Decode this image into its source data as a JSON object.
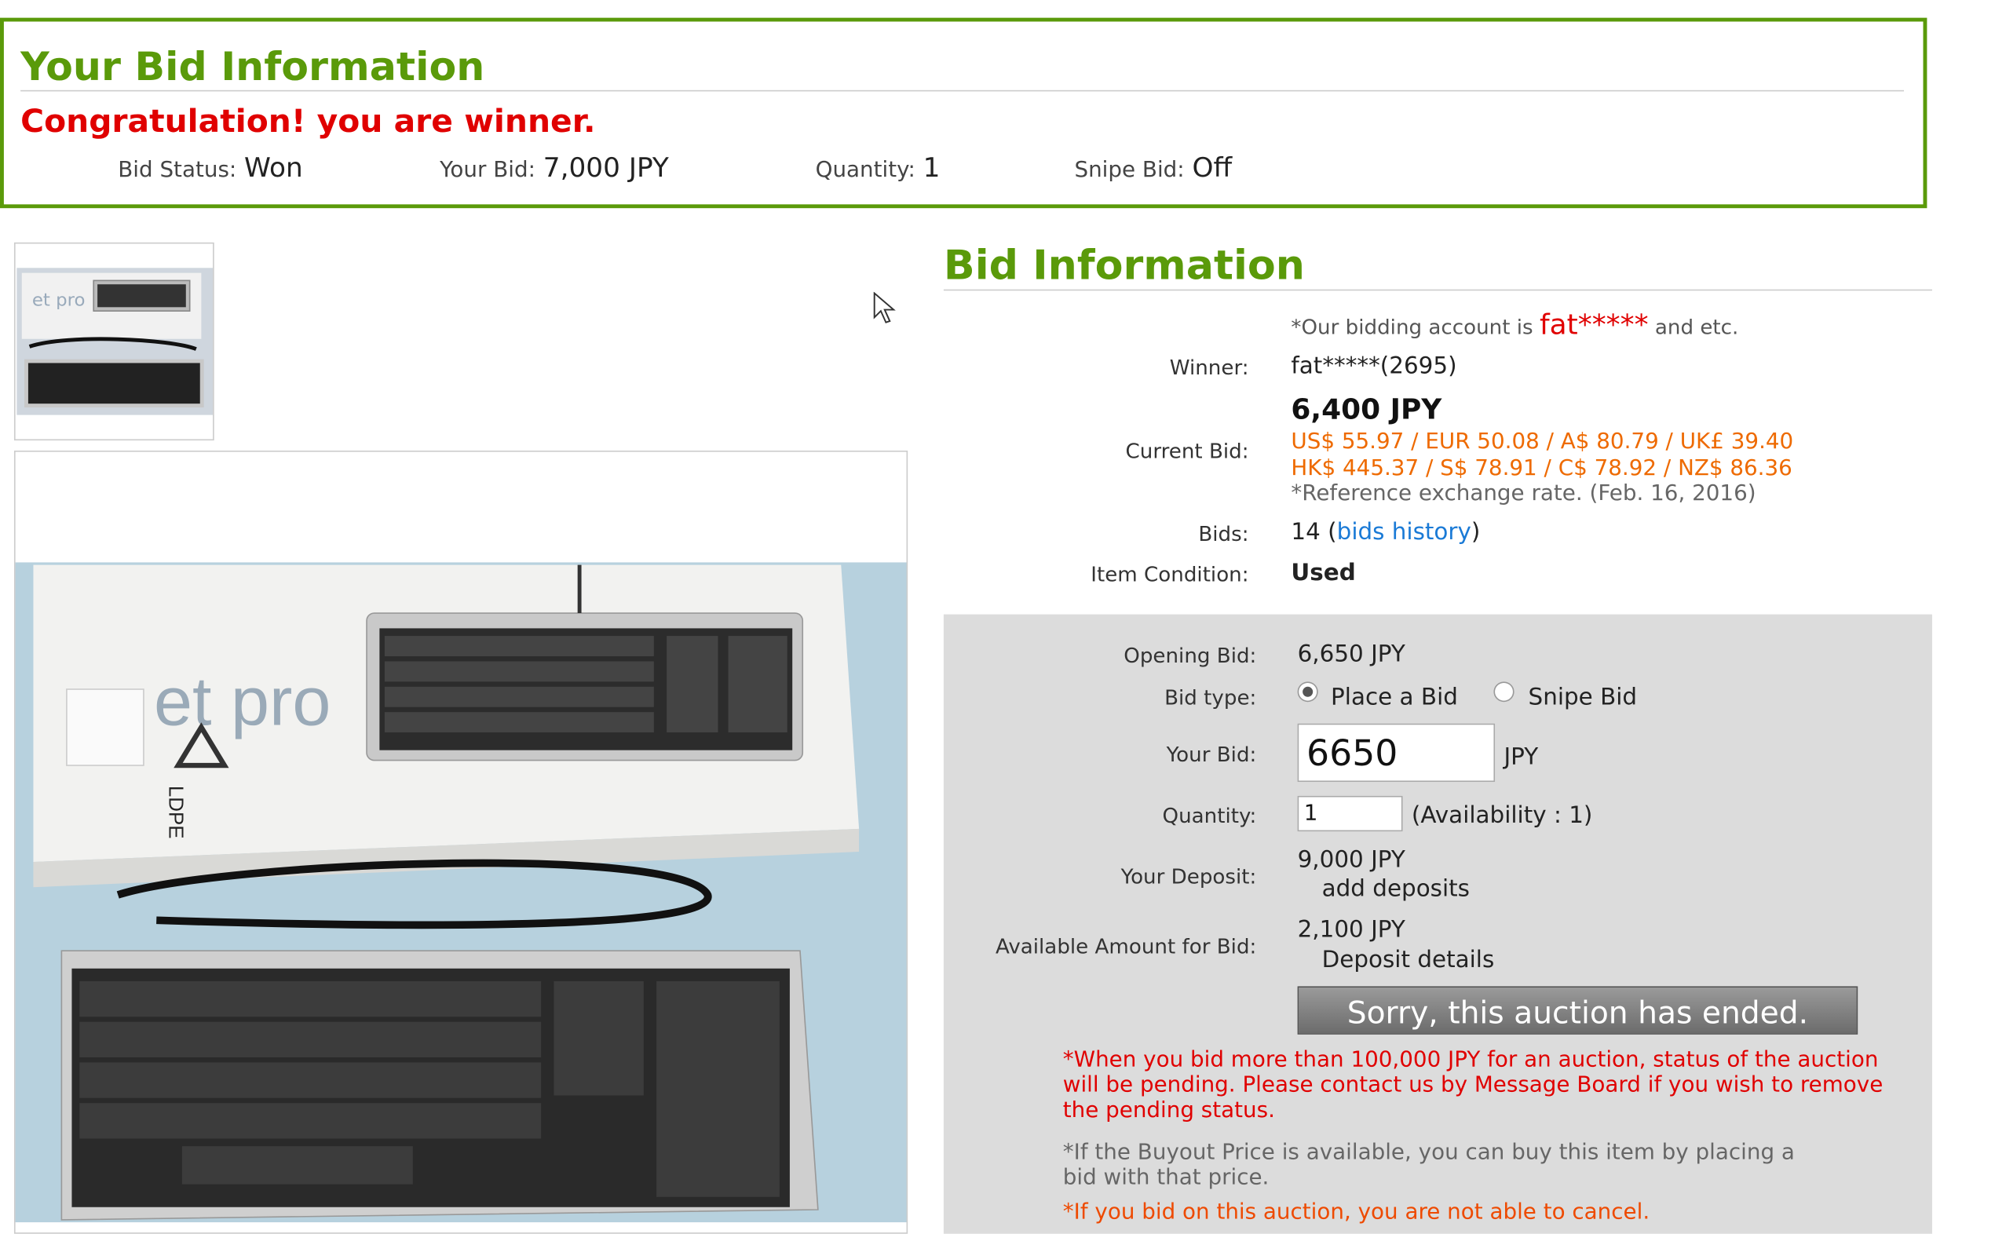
{
  "your_bid_box": {
    "title": "Your Bid Information",
    "congrats": "Congratulation! you are winner.",
    "bid_status_label": "Bid Status:",
    "bid_status_value": "Won",
    "your_bid_label": "Your Bid:",
    "your_bid_value": "7,000 JPY",
    "quantity_label": "Quantity:",
    "quantity_value": "1",
    "snipe_bid_label": "Snipe Bid:",
    "snipe_bid_value": "Off"
  },
  "bid_info": {
    "title": "Bid Information",
    "account_note_prefix": "*Our bidding account is",
    "account_note_name": "fat*****",
    "account_note_suffix": "and etc.",
    "winner_label": "Winner:",
    "winner_value": "fat*****(2695)",
    "current_bid_label": "Current Bid:",
    "current_bid_value": "6,400 JPY",
    "fx_line1": "US$ 55.97 /  EUR 50.08 /  A$ 80.79 /  UK£ 39.40",
    "fx_line2": "HK$ 445.37 /  S$ 78.91 /  C$ 78.92 /  NZ$ 86.36",
    "fx_note": "*Reference exchange rate. (Feb. 16, 2016)",
    "bids_label": "Bids:",
    "bids_count": "14 (",
    "bids_history_link": "bids history",
    "bids_close": ")",
    "condition_label": "Item Condition:",
    "condition_value": "Used"
  },
  "form": {
    "opening_bid_label": "Opening Bid:",
    "opening_bid_value": "6,650 JPY",
    "bid_type_label": "Bid type:",
    "bid_type_place": "Place a Bid",
    "bid_type_snipe": "Snipe Bid",
    "bid_type_selected": "Place a Bid",
    "your_bid_label": "Your Bid:",
    "your_bid_value": "6650",
    "your_bid_unit": "JPY",
    "quantity_label": "Quantity:",
    "quantity_value": "1",
    "availability": "(Availability : 1)",
    "deposit_label": "Your Deposit:",
    "deposit_value": "9,000 JPY",
    "add_deposits_link": "add deposits",
    "available_label": "Available Amount for Bid:",
    "available_value": "2,100 JPY",
    "deposit_details_link": "Deposit details",
    "ended_button": "Sorry, this auction has ended.",
    "warn_pending": "*When you bid more than 100,000 JPY for an auction, status of the auction will be pending. Please contact us by Message Board if you wish to remove the pending status.",
    "warn_buyout": "*If the Buyout Price is available, you can buy this item by placing a bid with that price.",
    "warn_cancel": "*If you bid on this auction, you are not able to cancel."
  },
  "images": {
    "box_text": "et pro",
    "box_side_text": "LDPE"
  },
  "colors": {
    "accent_green": "#5a9a0a",
    "winner_red": "#e00000",
    "fx_orange": "#ee6a00",
    "link_blue": "#1a7ad6",
    "panel_gray": "#dcdcdc"
  }
}
